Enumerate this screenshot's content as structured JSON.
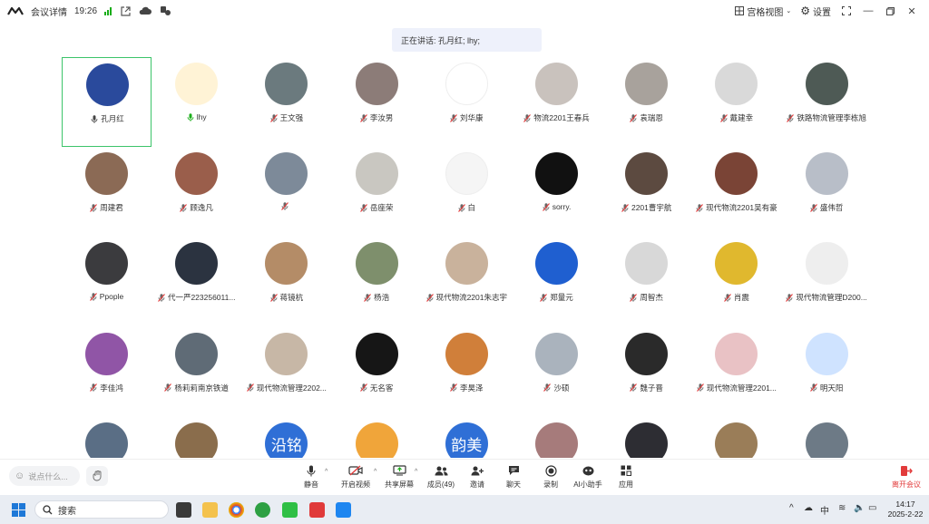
{
  "titlebar": {
    "title": "会议详情",
    "time": "19:26",
    "view_label": "宫格视图",
    "settings_label": "设置"
  },
  "speaking": {
    "text": "正在讲话: 孔月红; lhy;"
  },
  "participants": [
    {
      "name": "孔月红",
      "bg": "#2a4a9c",
      "mic": "on",
      "active": true
    },
    {
      "name": "lhy",
      "bg": "#fff3d6",
      "mic": "speaking"
    },
    {
      "name": "王文强",
      "bg": "#6b7a7e",
      "mic": "muted"
    },
    {
      "name": "李汝男",
      "bg": "#8c7c78",
      "mic": "muted"
    },
    {
      "name": "刘华康",
      "bg": "#ffffff",
      "mic": "muted"
    },
    {
      "name": "物流2201王春兵",
      "bg": "#c9c2bd",
      "mic": "muted"
    },
    {
      "name": "袁瑞恩",
      "bg": "#a8a29c",
      "mic": "muted"
    },
    {
      "name": "戴建幸",
      "bg": "#d9d9d9",
      "mic": "muted"
    },
    {
      "name": "铁路物流管理李栋旭",
      "bg": "#4e5a55",
      "mic": "muted"
    },
    {
      "name": "周建君",
      "bg": "#8b6a55",
      "mic": "muted"
    },
    {
      "name": "顾逸凡",
      "bg": "#9a5e4b",
      "mic": "muted"
    },
    {
      "name": "",
      "bg": "#7d8a99",
      "mic": "muted"
    },
    {
      "name": "岳座荣",
      "bg": "#c9c7c1",
      "mic": "muted"
    },
    {
      "name": "白",
      "bg": "#f5f5f5",
      "mic": "muted"
    },
    {
      "name": "sorry.",
      "bg": "#111111",
      "mic": "muted"
    },
    {
      "name": "2201曹宇航",
      "bg": "#5c4a40",
      "mic": "muted"
    },
    {
      "name": "现代物流2201吴有豪",
      "bg": "#7a4436",
      "mic": "muted"
    },
    {
      "name": "盛伟哲",
      "bg": "#b8bec8",
      "mic": "muted"
    },
    {
      "name": "Ppople",
      "bg": "#3b3b3e",
      "mic": "muted"
    },
    {
      "name": "代一严223256011...",
      "bg": "#2b3340",
      "mic": "muted"
    },
    {
      "name": "蒋镜杭",
      "bg": "#b48c67",
      "mic": "muted"
    },
    {
      "name": "杨浩",
      "bg": "#7e8f6c",
      "mic": "muted"
    },
    {
      "name": "现代物流2201朱志宇",
      "bg": "#c9b29c",
      "mic": "muted"
    },
    {
      "name": "郑量元",
      "bg": "#1f5fd0",
      "mic": "muted"
    },
    {
      "name": "周智杰",
      "bg": "#d8d8d8",
      "mic": "muted"
    },
    {
      "name": "肖震",
      "bg": "#e0b82e",
      "mic": "muted"
    },
    {
      "name": "现代物流管理D200...",
      "bg": "#eeeeee",
      "mic": "muted"
    },
    {
      "name": "李佳鸿",
      "bg": "#9055a6",
      "mic": "muted"
    },
    {
      "name": "杨莉莉南京铁道",
      "bg": "#5f6b76",
      "mic": "muted"
    },
    {
      "name": "现代物流管理2202...",
      "bg": "#c7b7a6",
      "mic": "muted"
    },
    {
      "name": "无名客",
      "bg": "#161616",
      "mic": "muted"
    },
    {
      "name": "李昊泽",
      "bg": "#d07f3a",
      "mic": "muted"
    },
    {
      "name": "沙硕",
      "bg": "#aab3bd",
      "mic": "muted"
    },
    {
      "name": "魏子晋",
      "bg": "#2a2a2a",
      "mic": "muted"
    },
    {
      "name": "现代物流管理2201...",
      "bg": "#e9c2c5",
      "mic": "muted"
    },
    {
      "name": "明天阳",
      "bg": "#cfe3ff",
      "mic": "muted"
    },
    {
      "name": "",
      "bg": "#5a6e85",
      "mic": "none"
    },
    {
      "name": "",
      "bg": "#8a6d4c",
      "mic": "none"
    },
    {
      "name": "",
      "bg": "#2f6fd6",
      "mic": "none",
      "text": "沿铭"
    },
    {
      "name": "",
      "bg": "#f0a53a",
      "mic": "none"
    },
    {
      "name": "",
      "bg": "#2f6fd6",
      "mic": "none",
      "text": "韵美"
    },
    {
      "name": "",
      "bg": "#a67b7b",
      "mic": "none"
    },
    {
      "name": "",
      "bg": "#2d2d33",
      "mic": "none"
    },
    {
      "name": "",
      "bg": "#9a7d58",
      "mic": "none"
    },
    {
      "name": "",
      "bg": "#6d7a86",
      "mic": "none"
    }
  ],
  "toolbar": {
    "chat_placeholder": "说点什么...",
    "mute": "静音",
    "video": "开启视频",
    "share": "共享屏幕",
    "members": "成员(49)",
    "invite": "邀请",
    "chat": "聊天",
    "record": "录制",
    "ai": "AI小助手",
    "apps": "应用",
    "leave": "离开会议"
  },
  "taskbar": {
    "search_placeholder": "搜索",
    "time": "14:17",
    "date": "2025-2-22"
  },
  "colors": {
    "accent_green": "#3cc46a",
    "leave_red": "#e23b3b",
    "banner_bg": "#eef1fb",
    "taskbar_bg": "#e9edf3"
  }
}
